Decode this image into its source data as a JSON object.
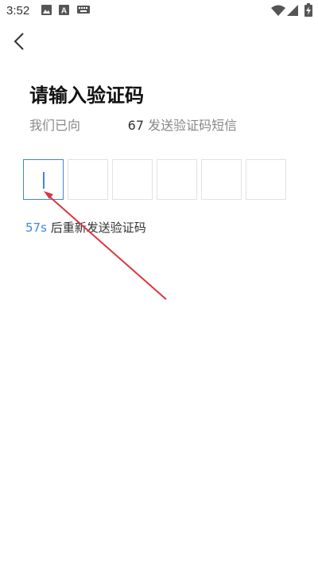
{
  "status_bar": {
    "time": "3:52",
    "icons": [
      "image-icon",
      "a-letter-icon",
      "keyboard-icon",
      "wifi-icon",
      "signal-icon",
      "battery-charging-icon"
    ]
  },
  "header": {
    "back_icon": "chevron-left-icon"
  },
  "page": {
    "title": "请输入验证码",
    "subtitle_prefix": "我们已向",
    "phone_suffix": "67",
    "subtitle_suffix": "发送验证码短信"
  },
  "code_input": {
    "length": 6,
    "values": [
      "",
      "",
      "",
      "",
      "",
      ""
    ],
    "active_index": 0
  },
  "resend": {
    "countdown": "57s",
    "text": "后重新发送验证码"
  },
  "colors": {
    "accent": "#3f86e0",
    "annotation_arrow": "#d9363e",
    "box_border": "#e2e2e2"
  }
}
